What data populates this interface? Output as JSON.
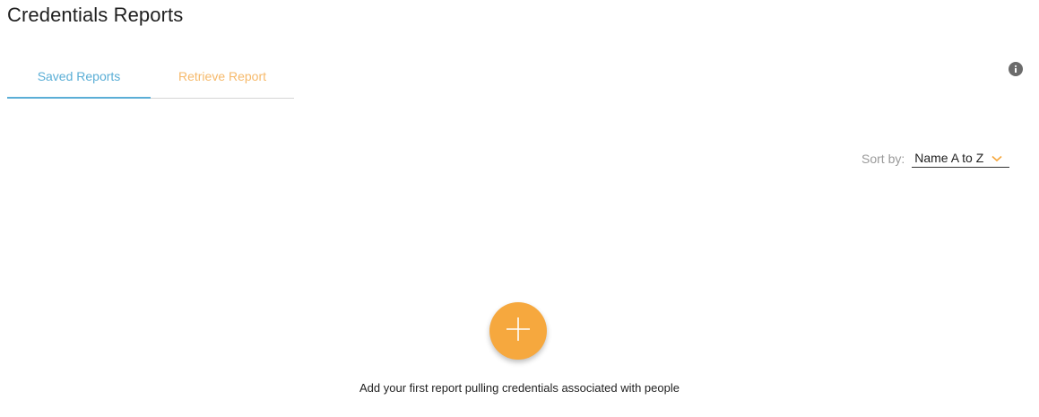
{
  "header": {
    "title": "Credentials Reports"
  },
  "tabs": [
    {
      "label": "Saved Reports",
      "active": true,
      "color": "#5aaed6"
    },
    {
      "label": "Retrieve Report",
      "active": false,
      "color": "#f6b96a"
    }
  ],
  "toolbar": {
    "info_icon": "info-icon"
  },
  "sort": {
    "label": "Sort by:",
    "selected": "Name A to Z",
    "chevron_icon": "chevron-down-icon"
  },
  "empty_state": {
    "add_icon": "plus-icon",
    "accent": "#f6a83e",
    "message": "Add your first report pulling credentials associated with people"
  }
}
